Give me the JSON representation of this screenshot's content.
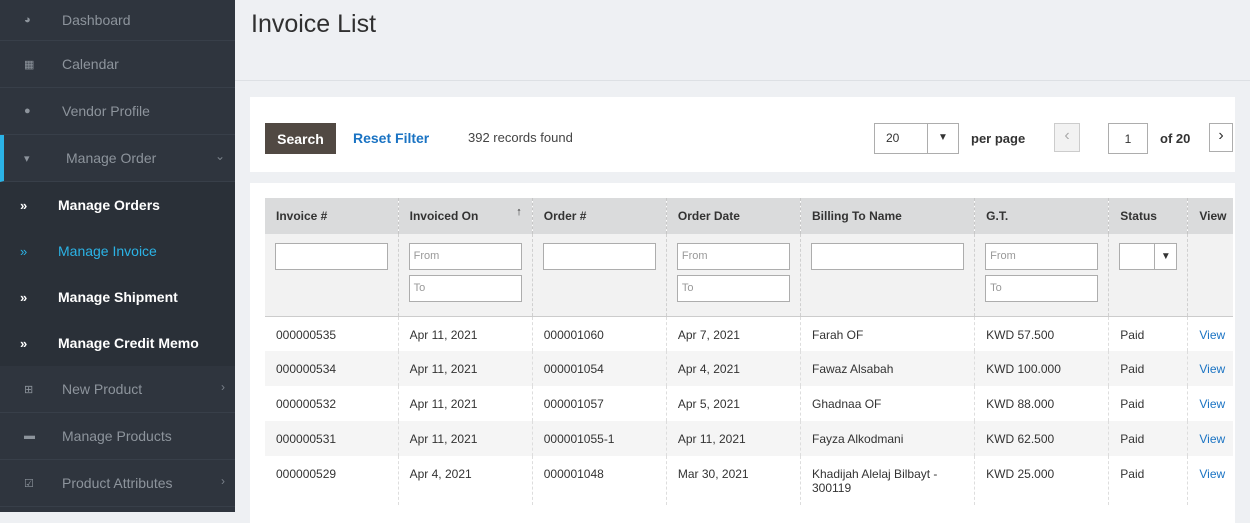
{
  "sidebar": {
    "items": [
      {
        "label": "Dashboard",
        "icon": "dashboard-icon",
        "glyph": "◕"
      },
      {
        "label": "Calendar",
        "icon": "calendar-icon",
        "glyph": "▦"
      },
      {
        "label": "Vendor Profile",
        "icon": "user-icon",
        "glyph": "●"
      },
      {
        "label": "Manage Order",
        "icon": "cart-icon",
        "glyph": "▾"
      }
    ],
    "subitems": [
      {
        "label": "Manage Orders"
      },
      {
        "label": "Manage Invoice"
      },
      {
        "label": "Manage Shipment"
      },
      {
        "label": "Manage Credit Memo"
      }
    ],
    "items_after": [
      {
        "label": "New Product",
        "icon": "plus-square-icon",
        "glyph": "⊞"
      },
      {
        "label": "Manage Products",
        "icon": "folder-icon",
        "glyph": "▬"
      },
      {
        "label": "Product Attributes",
        "icon": "check-square-icon",
        "glyph": "☑"
      }
    ]
  },
  "page": {
    "title": "Invoice List"
  },
  "toolbar": {
    "search_label": "Search",
    "reset_label": "Reset Filter",
    "records_text": "392 records found",
    "per_page_value": "20",
    "per_page_label": "per page",
    "current_page": "1",
    "of_pages": "of 20"
  },
  "grid": {
    "headers": [
      "Invoice #",
      "Invoiced On",
      "Order #",
      "Order Date",
      "Billing To Name",
      "G.T.",
      "Status",
      "View"
    ],
    "filters": {
      "from_placeholder": "From",
      "to_placeholder": "To"
    },
    "rows": [
      {
        "invoice": "000000535",
        "invoiced_on": "Apr 11, 2021",
        "order": "000001060",
        "order_date": "Apr 7, 2021",
        "billing": "Farah OF",
        "gt": "KWD 57.500",
        "status": "Paid",
        "view": "View"
      },
      {
        "invoice": "000000534",
        "invoiced_on": "Apr 11, 2021",
        "order": "000001054",
        "order_date": "Apr 4, 2021",
        "billing": "Fawaz Alsabah",
        "gt": "KWD 100.000",
        "status": "Paid",
        "view": "View"
      },
      {
        "invoice": "000000532",
        "invoiced_on": "Apr 11, 2021",
        "order": "000001057",
        "order_date": "Apr 5, 2021",
        "billing": "Ghadnaa OF",
        "gt": "KWD 88.000",
        "status": "Paid",
        "view": "View"
      },
      {
        "invoice": "000000531",
        "invoiced_on": "Apr 11, 2021",
        "order": "000001055-1",
        "order_date": "Apr 11, 2021",
        "billing": "Fayza Alkodmani",
        "gt": "KWD 62.500",
        "status": "Paid",
        "view": "View"
      },
      {
        "invoice": "000000529",
        "invoiced_on": "Apr 4, 2021",
        "order": "000001048",
        "order_date": "Mar 30, 2021",
        "billing": "Khadijah Alelaj Bilbayt - 300119",
        "gt": "KWD 25.000",
        "status": "Paid",
        "view": "View"
      }
    ]
  }
}
